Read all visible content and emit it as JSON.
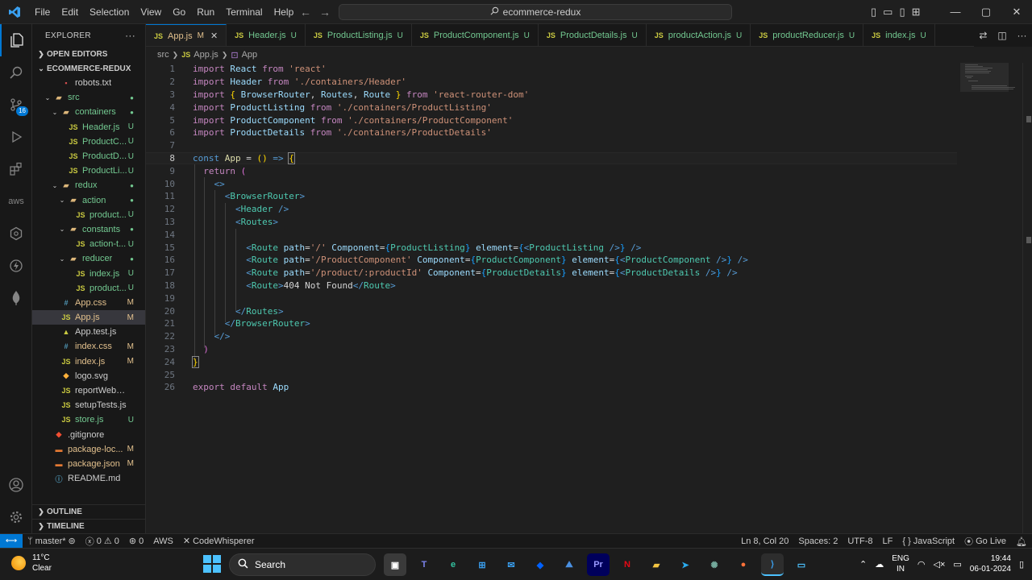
{
  "titlebar": {
    "logo": "⟩",
    "menu": [
      "File",
      "Edit",
      "Selection",
      "View",
      "Go",
      "Run",
      "Terminal",
      "Help"
    ],
    "search": "ecommerce-redux",
    "back_icon": "←",
    "forward_icon": "→"
  },
  "explorer": {
    "title": "EXPLORER",
    "more": "···",
    "open_editors": "OPEN EDITORS",
    "project": "ECOMMERCE-REDUX",
    "items": [
      {
        "name": "robots.txt",
        "icon": "▪",
        "icls": "txt",
        "indent": 2,
        "chev": "",
        "status": "",
        "scls": "",
        "ncls": ""
      },
      {
        "name": "src",
        "icon": "▰",
        "icls": "folder",
        "indent": 1,
        "chev": "⌄",
        "status": "●",
        "scls": "dot",
        "ncls": "new"
      },
      {
        "name": "containers",
        "icon": "▰",
        "icls": "folder",
        "indent": 2,
        "chev": "⌄",
        "status": "●",
        "scls": "dot",
        "ncls": "new"
      },
      {
        "name": "Header.js",
        "icon": "JS",
        "icls": "js",
        "indent": 3,
        "chev": "",
        "status": "U",
        "scls": "U",
        "ncls": "new"
      },
      {
        "name": "ProductC...",
        "icon": "JS",
        "icls": "js",
        "indent": 3,
        "chev": "",
        "status": "U",
        "scls": "U",
        "ncls": "new"
      },
      {
        "name": "ProductD...",
        "icon": "JS",
        "icls": "js",
        "indent": 3,
        "chev": "",
        "status": "U",
        "scls": "U",
        "ncls": "new"
      },
      {
        "name": "ProductLi...",
        "icon": "JS",
        "icls": "js",
        "indent": 3,
        "chev": "",
        "status": "U",
        "scls": "U",
        "ncls": "new"
      },
      {
        "name": "redux",
        "icon": "▰",
        "icls": "folder",
        "indent": 2,
        "chev": "⌄",
        "status": "●",
        "scls": "dot",
        "ncls": "new"
      },
      {
        "name": "action",
        "icon": "▰",
        "icls": "folder",
        "indent": 3,
        "chev": "⌄",
        "status": "●",
        "scls": "dot",
        "ncls": "new"
      },
      {
        "name": "product...",
        "icon": "JS",
        "icls": "js",
        "indent": 4,
        "chev": "",
        "status": "U",
        "scls": "U",
        "ncls": "new"
      },
      {
        "name": "constants",
        "icon": "▰",
        "icls": "folder",
        "indent": 3,
        "chev": "⌄",
        "status": "●",
        "scls": "dot",
        "ncls": "new"
      },
      {
        "name": "action-t...",
        "icon": "JS",
        "icls": "js",
        "indent": 4,
        "chev": "",
        "status": "U",
        "scls": "U",
        "ncls": "new"
      },
      {
        "name": "reducer",
        "icon": "▰",
        "icls": "folder",
        "indent": 3,
        "chev": "⌄",
        "status": "●",
        "scls": "dot",
        "ncls": "new"
      },
      {
        "name": "index.js",
        "icon": "JS",
        "icls": "js",
        "indent": 4,
        "chev": "",
        "status": "U",
        "scls": "U",
        "ncls": "new"
      },
      {
        "name": "product...",
        "icon": "JS",
        "icls": "js",
        "indent": 4,
        "chev": "",
        "status": "U",
        "scls": "U",
        "ncls": "new"
      },
      {
        "name": "App.css",
        "icon": "#",
        "icls": "css",
        "indent": 2,
        "chev": "",
        "status": "M",
        "scls": "M",
        "ncls": "mod"
      },
      {
        "name": "App.js",
        "icon": "JS",
        "icls": "js",
        "indent": 2,
        "chev": "",
        "status": "M",
        "scls": "M",
        "ncls": "mod",
        "selected": true
      },
      {
        "name": "App.test.js",
        "icon": "▲",
        "icls": "js",
        "indent": 2,
        "chev": "",
        "status": "",
        "scls": "",
        "ncls": ""
      },
      {
        "name": "index.css",
        "icon": "#",
        "icls": "css",
        "indent": 2,
        "chev": "",
        "status": "M",
        "scls": "M",
        "ncls": "mod"
      },
      {
        "name": "index.js",
        "icon": "JS",
        "icls": "js",
        "indent": 2,
        "chev": "",
        "status": "M",
        "scls": "M",
        "ncls": "mod"
      },
      {
        "name": "logo.svg",
        "icon": "◆",
        "icls": "svg",
        "indent": 2,
        "chev": "",
        "status": "",
        "scls": "",
        "ncls": ""
      },
      {
        "name": "reportWebVitals.js",
        "icon": "JS",
        "icls": "js",
        "indent": 2,
        "chev": "",
        "status": "",
        "scls": "",
        "ncls": ""
      },
      {
        "name": "setupTests.js",
        "icon": "JS",
        "icls": "js",
        "indent": 2,
        "chev": "",
        "status": "",
        "scls": "",
        "ncls": ""
      },
      {
        "name": "store.js",
        "icon": "JS",
        "icls": "js",
        "indent": 2,
        "chev": "",
        "status": "U",
        "scls": "U",
        "ncls": "new"
      },
      {
        "name": ".gitignore",
        "icon": "◆",
        "icls": "git",
        "indent": 1,
        "chev": "",
        "status": "",
        "scls": "",
        "ncls": ""
      },
      {
        "name": "package-loc...",
        "icon": "▬",
        "icls": "pkg",
        "indent": 1,
        "chev": "",
        "status": "M",
        "scls": "M",
        "ncls": "mod"
      },
      {
        "name": "package.json",
        "icon": "▬",
        "icls": "pkg",
        "indent": 1,
        "chev": "",
        "status": "M",
        "scls": "M",
        "ncls": "mod"
      },
      {
        "name": "README.md",
        "icon": "ⓘ",
        "icls": "md",
        "indent": 1,
        "chev": "",
        "status": "",
        "scls": "",
        "ncls": ""
      }
    ],
    "outline": "OUTLINE",
    "timeline": "TIMELINE"
  },
  "tabs": [
    {
      "name": "App.js",
      "status": "M",
      "active": true
    },
    {
      "name": "Header.js",
      "status": "U"
    },
    {
      "name": "ProductListing.js",
      "status": "U"
    },
    {
      "name": "ProductComponent.js",
      "status": "U"
    },
    {
      "name": "ProductDetails.js",
      "status": "U"
    },
    {
      "name": "productAction.js",
      "status": "U"
    },
    {
      "name": "productReducer.js",
      "status": "U"
    },
    {
      "name": "index.js",
      "status": "U"
    }
  ],
  "breadcrumb": {
    "folder": "src",
    "file": "App.js",
    "symbol": "App",
    "js": "JS",
    "sym_icon": "⊡"
  },
  "activity": {
    "badge": "16"
  },
  "status": {
    "remote": "⟷",
    "branch": "master*",
    "errors": "0",
    "warnings": "0",
    "ports": "0",
    "aws": "AWS",
    "codewhisperer": "CodeWhisperer",
    "position": "Ln 8, Col 20",
    "spaces": "Spaces: 2",
    "encoding": "UTF-8",
    "eol": "LF",
    "language": "JavaScript",
    "golive": "Go Live"
  },
  "taskbar": {
    "temp": "11°C",
    "weather": "Clear",
    "search": "Search",
    "lang1": "ENG",
    "lang2": "IN",
    "time": "19:44",
    "date": "06-01-2024"
  },
  "colors": {
    "accent": "#0078d4",
    "modified": "#e2c08d",
    "untracked": "#73c991"
  }
}
